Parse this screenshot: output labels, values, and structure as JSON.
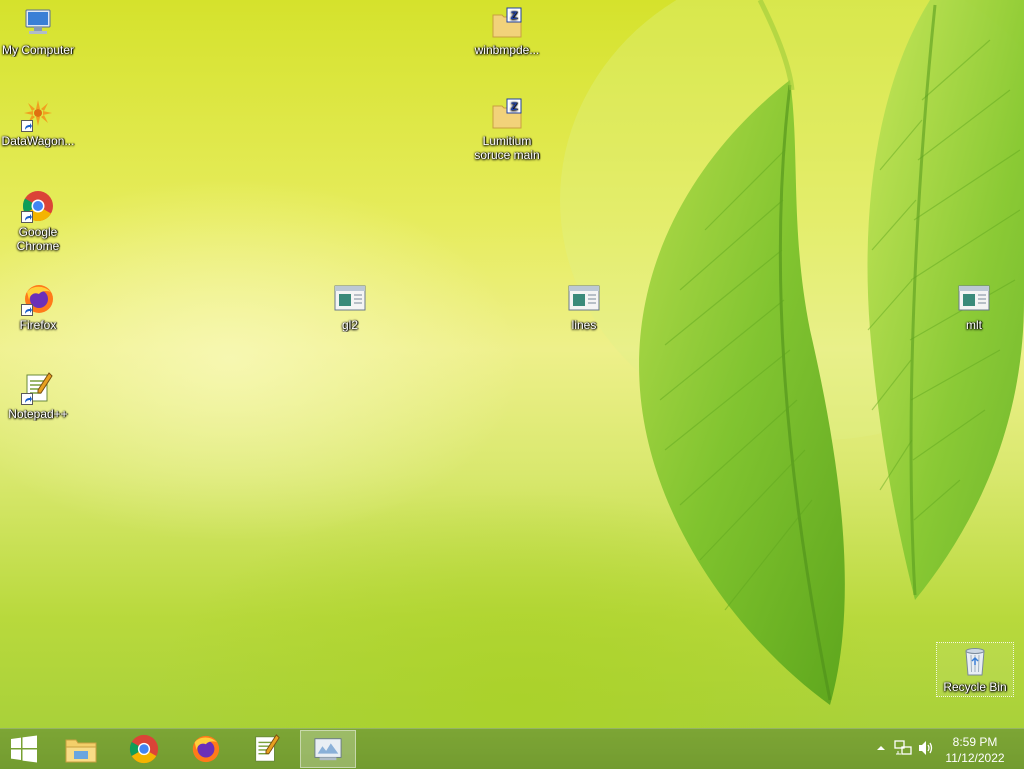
{
  "desktop": {
    "icons": {
      "my_computer": "My Computer",
      "datawagon": "DataWagon...",
      "google_chrome": "Google Chrome",
      "firefox": "Firefox",
      "notepadpp": "Notepad++",
      "winbmpde": "winbmpde...",
      "lumitium": "Lumitium soruce main",
      "gl2": "gl2",
      "lines": "lines",
      "mlt": "mlt",
      "recycle_bin": "Recycle Bin"
    }
  },
  "taskbar": {
    "pinned": [
      "windows-start-icon",
      "file-explorer-icon",
      "chrome-icon",
      "firefox-icon",
      "notepadpp-icon",
      "active-app-icon"
    ],
    "clock": {
      "time": "8:59 PM",
      "date": "11/12/2022"
    }
  },
  "colors": {
    "taskbar": "#76a034",
    "desktop_top": "#d5e22c",
    "desktop_bottom": "#a9d13a"
  }
}
